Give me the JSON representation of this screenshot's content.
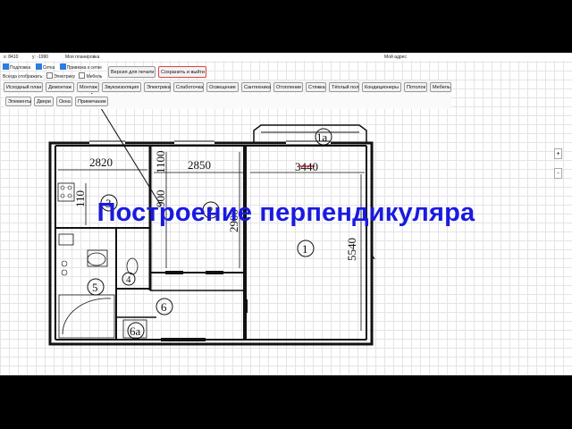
{
  "header": {
    "coord_x": "x: 8410",
    "coord_y": "y: -1990",
    "plan_name": "Моя планировка",
    "address": "Мой адрес"
  },
  "options": {
    "underlay": "Подложка",
    "grid": "Сетка",
    "snap": "Привязка к сетке",
    "always_show": "Всегда отображать:",
    "electrics": "Электрику",
    "furniture": "Мебель"
  },
  "actions": {
    "print_version": "Версия для печати",
    "save_exit": "Сохранить и выйти"
  },
  "tabs": [
    "Исходный план",
    "Демонтаж",
    "Монтаж",
    "Звукоизоляция",
    "Электрика",
    "Слаботочка",
    "Освещение",
    "Сантехника",
    "Отопление",
    "Стяжка",
    "Тёплый пол",
    "Кондиционеры",
    "Потолок",
    "Мебель"
  ],
  "subtabs": [
    "Элементы",
    "Двери",
    "Окна",
    "Примечание"
  ],
  "zoom": {
    "plus": "+",
    "minus": "-"
  },
  "plan": {
    "room_labels": [
      "1",
      "1а",
      "2",
      "3",
      "4",
      "5",
      "6",
      "6а"
    ],
    "dimensions": {
      "d2820": "2820",
      "d2850": "2850",
      "d3440": "3440",
      "d5540": "5540",
      "d1100": "1100",
      "d900": "900",
      "d110": "110",
      "d2900": "2900"
    }
  },
  "overlay_title": "Построение перпендикуляра",
  "colors": {
    "accent": "#1a1adf",
    "wall": "#111111",
    "grid": "#e4e4e4"
  }
}
